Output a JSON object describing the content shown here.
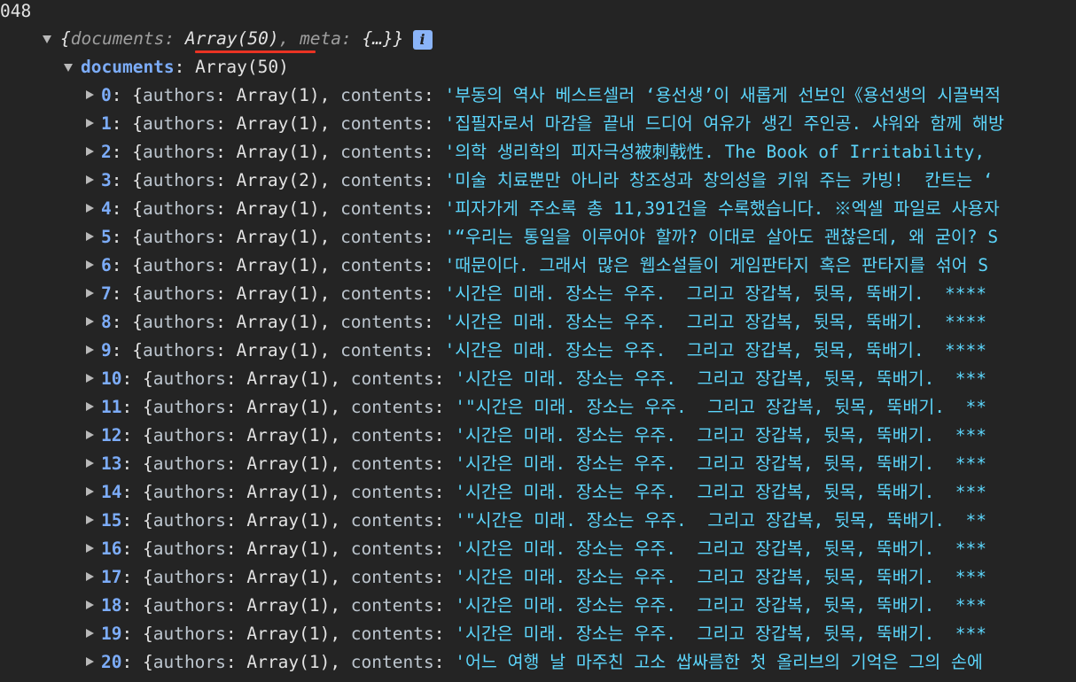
{
  "top_partial": "048",
  "summary": {
    "open": "{",
    "documents_key": "documents",
    "documents_val": "Array(50)",
    "meta_key": "meta",
    "meta_val": "{…}",
    "close": "}",
    "info_icon": "i"
  },
  "documents_line": {
    "key": "documents",
    "value": "Array(50)"
  },
  "rows": [
    {
      "index": "0",
      "authors": "Array(1)",
      "contents": "'부동의 역사 베스트셀러 ‘용선생’이 새롭게 선보인《용선생의 시끌벅적"
    },
    {
      "index": "1",
      "authors": "Array(1)",
      "contents": "'집필자로서 마감을 끝내 드디어 여유가 생긴 주인공. 샤워와 함께 해방"
    },
    {
      "index": "2",
      "authors": "Array(1)",
      "contents": "'의학 생리학의 피자극성被刺戟性. The Book of Irritability,"
    },
    {
      "index": "3",
      "authors": "Array(2)",
      "contents": "'미술 치료뿐만 아니라 창조성과 창의성을 키워 주는 카빙!  칸트는 ‘"
    },
    {
      "index": "4",
      "authors": "Array(1)",
      "contents": "'피자가게 주소록 총 11,391건을 수록했습니다. ※엑셀 파일로 사용자"
    },
    {
      "index": "5",
      "authors": "Array(1)",
      "contents": "'“우리는 통일을 이루어야 할까? 이대로 살아도 괜찮은데, 왜 굳이? S"
    },
    {
      "index": "6",
      "authors": "Array(1)",
      "contents": "'때문이다. 그래서 많은 웹소설들이 게임판타지 혹은 판타지를 섞어 S"
    },
    {
      "index": "7",
      "authors": "Array(1)",
      "contents": "'시간은 미래. 장소는 우주.  그리고 장갑복, 뒷목, 뚝배기.  ****"
    },
    {
      "index": "8",
      "authors": "Array(1)",
      "contents": "'시간은 미래. 장소는 우주.  그리고 장갑복, 뒷목, 뚝배기.  ****"
    },
    {
      "index": "9",
      "authors": "Array(1)",
      "contents": "'시간은 미래. 장소는 우주.  그리고 장갑복, 뒷목, 뚝배기.  ****"
    },
    {
      "index": "10",
      "authors": "Array(1)",
      "contents": "'시간은 미래. 장소는 우주.  그리고 장갑복, 뒷목, 뚝배기.  ***"
    },
    {
      "index": "11",
      "authors": "Array(1)",
      "contents": "'\"시간은 미래. 장소는 우주.  그리고 장갑복, 뒷목, 뚝배기.  **"
    },
    {
      "index": "12",
      "authors": "Array(1)",
      "contents": "'시간은 미래. 장소는 우주.  그리고 장갑복, 뒷목, 뚝배기.  ***"
    },
    {
      "index": "13",
      "authors": "Array(1)",
      "contents": "'시간은 미래. 장소는 우주.  그리고 장갑복, 뒷목, 뚝배기.  ***"
    },
    {
      "index": "14",
      "authors": "Array(1)",
      "contents": "'시간은 미래. 장소는 우주.  그리고 장갑복, 뒷목, 뚝배기.  ***"
    },
    {
      "index": "15",
      "authors": "Array(1)",
      "contents": "'\"시간은 미래. 장소는 우주.  그리고 장갑복, 뒷목, 뚝배기.  **"
    },
    {
      "index": "16",
      "authors": "Array(1)",
      "contents": "'시간은 미래. 장소는 우주.  그리고 장갑복, 뒷목, 뚝배기.  ***"
    },
    {
      "index": "17",
      "authors": "Array(1)",
      "contents": "'시간은 미래. 장소는 우주.  그리고 장갑복, 뒷목, 뚝배기.  ***"
    },
    {
      "index": "18",
      "authors": "Array(1)",
      "contents": "'시간은 미래. 장소는 우주.  그리고 장갑복, 뒷목, 뚝배기.  ***"
    },
    {
      "index": "19",
      "authors": "Array(1)",
      "contents": "'시간은 미래. 장소는 우주.  그리고 장갑복, 뒷목, 뚝배기.  ***"
    },
    {
      "index": "20",
      "authors": "Array(1)",
      "contents": "'어느 여행 날 마주친 고소 쌉싸름한 첫 올리브의 기억은 그의 손에"
    }
  ],
  "labels": {
    "authors": "authors",
    "contents": "contents"
  },
  "colors": {
    "background": "#242424",
    "key": "#7cacf8",
    "string": "#5cd5fb",
    "underline": "#ea3323"
  }
}
